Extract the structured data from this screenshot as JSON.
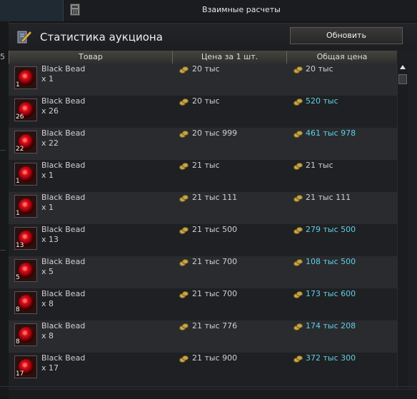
{
  "topbar": {
    "title": "Взаимные расчеты"
  },
  "left_strip": {
    "number": "5"
  },
  "panel": {
    "title": "Статистика аукциона",
    "refresh_label": "Обновить",
    "columns": [
      "Товар",
      "Цена за 1 шт.",
      "Общая цена"
    ]
  },
  "colors": {
    "normal_text": "#d0d0d0",
    "highlight_total": "#5fd0e6"
  },
  "rows": [
    {
      "name": "Black Bead",
      "count": "x 1",
      "qty": "1",
      "unit": "20 тыс",
      "total": "20 тыс",
      "highlight": false
    },
    {
      "name": "Black Bead",
      "count": "x 26",
      "qty": "26",
      "unit": "20 тыс",
      "total": "520 тыс",
      "highlight": true
    },
    {
      "name": "Black Bead",
      "count": "x 22",
      "qty": "22",
      "unit": "20 тыс 999",
      "total": "461 тыс 978",
      "highlight": true
    },
    {
      "name": "Black Bead",
      "count": "x 1",
      "qty": "1",
      "unit": "21 тыс",
      "total": "21 тыс",
      "highlight": false
    },
    {
      "name": "Black Bead",
      "count": "x 1",
      "qty": "1",
      "unit": "21 тыс 111",
      "total": "21 тыс 111",
      "highlight": false
    },
    {
      "name": "Black Bead",
      "count": "x 13",
      "qty": "13",
      "unit": "21 тыс 500",
      "total": "279 тыс 500",
      "highlight": true
    },
    {
      "name": "Black Bead",
      "count": "x 5",
      "qty": "5",
      "unit": "21 тыс 700",
      "total": "108 тыс 500",
      "highlight": true
    },
    {
      "name": "Black Bead",
      "count": "x 8",
      "qty": "8",
      "unit": "21 тыс 700",
      "total": "173 тыс 600",
      "highlight": true
    },
    {
      "name": "Black Bead",
      "count": "x 8",
      "qty": "8",
      "unit": "21 тыс 776",
      "total": "174 тыс 208",
      "highlight": true
    },
    {
      "name": "Black Bead",
      "count": "x 17",
      "qty": "17",
      "unit": "21 тыс 900",
      "total": "372 тыс 300",
      "highlight": true
    }
  ]
}
